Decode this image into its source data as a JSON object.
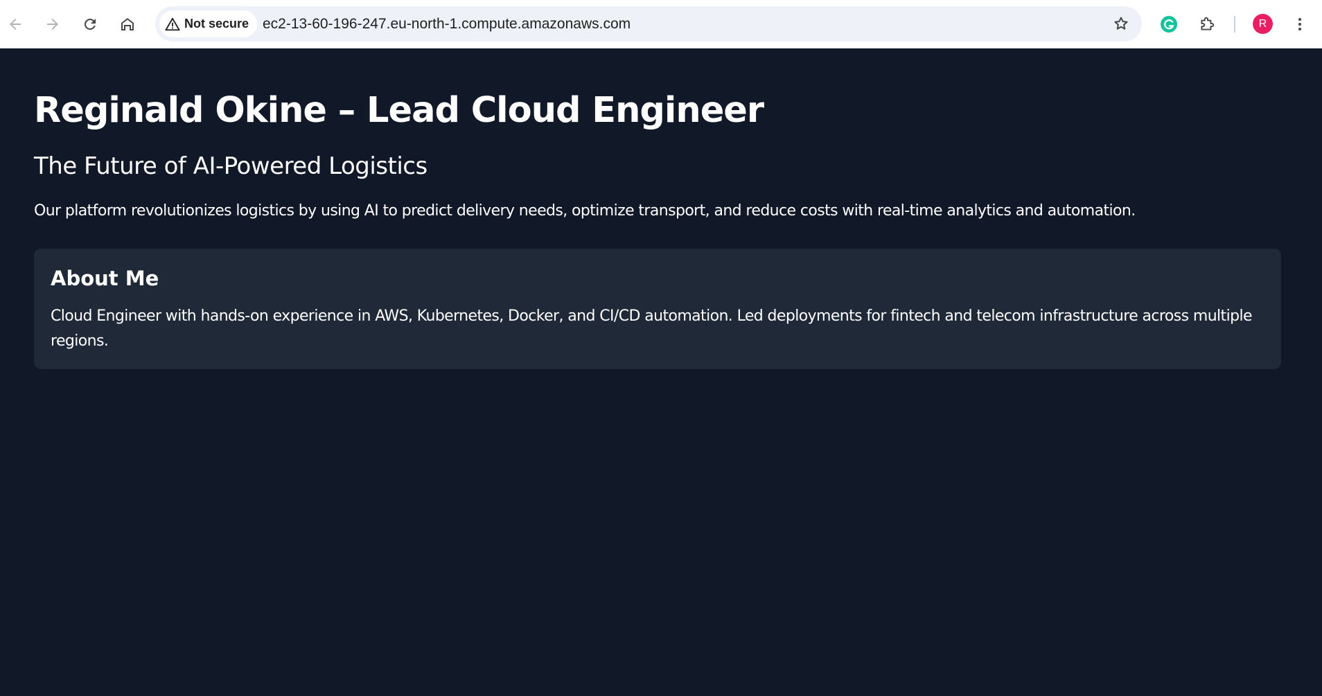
{
  "browser": {
    "security_label": "Not secure",
    "url": "ec2-13-60-196-247.eu-north-1.compute.amazonaws.com",
    "avatar_initial": "R",
    "icons": [
      "back-arrow-icon",
      "forward-arrow-icon",
      "reload-icon",
      "home-icon",
      "warning-icon",
      "star-icon",
      "grammarly-icon",
      "extensions-puzzle-icon",
      "kebab-menu-icon"
    ],
    "colors": {
      "avatar": "#e91e63",
      "grammarly": "#15c39a"
    }
  },
  "page": {
    "title": "Reginald Okine – Lead Cloud Engineer",
    "subtitle": "The Future of AI-Powered Logistics",
    "intro": "Our platform revolutionizes logistics by using AI to predict delivery needs, optimize transport, and reduce costs with real-time analytics and automation.",
    "about": {
      "heading": "About Me",
      "text": "Cloud Engineer with hands-on experience in AWS, Kubernetes, Docker, and CI/CD automation. Led deployments for fintech and telecom infrastructure across multiple regions."
    },
    "colors": {
      "background": "#111827",
      "card": "#1f2937",
      "text": "#ffffff"
    }
  }
}
